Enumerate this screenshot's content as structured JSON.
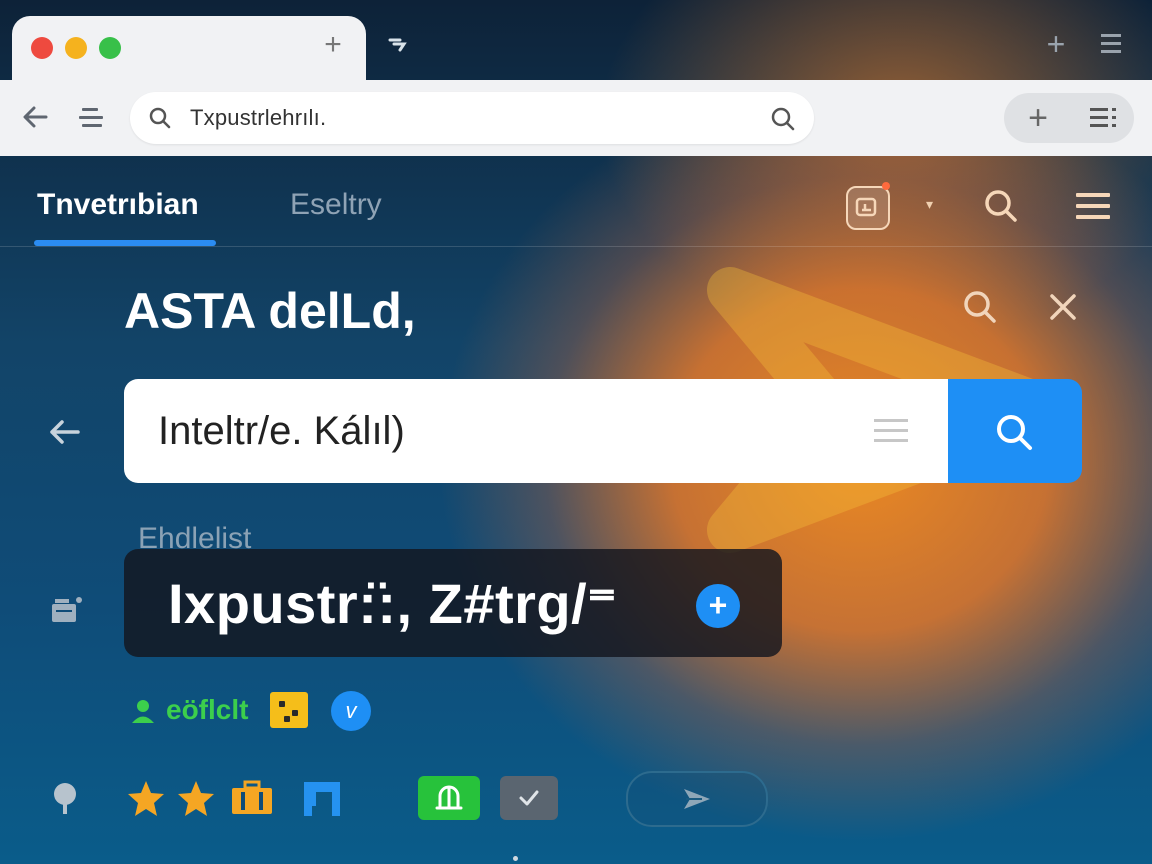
{
  "browser": {
    "tab_plus_label": "+",
    "window_plus_label": "+",
    "address_bar": {
      "text": "Txpustrlehrılı."
    },
    "pill_plus_label": "+"
  },
  "app_nav": {
    "tabs": [
      {
        "label": "Tnvetrıbian",
        "active": true
      },
      {
        "label": "Eseltry",
        "active": false
      }
    ],
    "caret": "▾"
  },
  "page": {
    "title": "ASTA delLd,"
  },
  "search": {
    "value": "Inteltr/e. Kálıl)"
  },
  "results": {
    "subheading": "Ehdlelist",
    "suggestion": {
      "text": "Ixpustr:̈:, Z#trg/⁼",
      "add_label": "+"
    },
    "badges": {
      "green_label": "eöflclt",
      "blue_circle_label": "v"
    }
  },
  "colors": {
    "accent_blue": "#1e8ff5",
    "tab_underline": "#2b8cf2",
    "green": "#27c23b",
    "yellow": "#f5be1a",
    "star": "#f5a623",
    "glow_orange": "#f68c1e"
  },
  "icons": [
    "search-icon",
    "close-icon",
    "back-arrow-icon",
    "menu-icon",
    "list-icon",
    "pin-icon",
    "star-icon",
    "briefcase-icon",
    "flag-icon",
    "check-icon",
    "send-icon"
  ]
}
